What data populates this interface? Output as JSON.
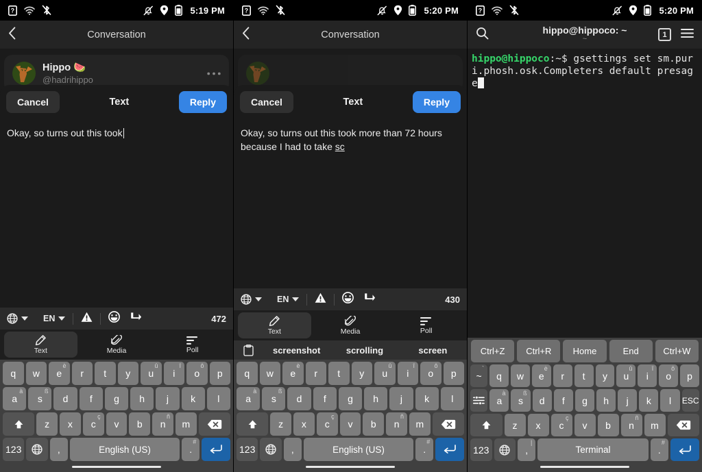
{
  "panels": [
    {
      "id": "panel-compose-start",
      "statusbar": {
        "time": "5:19 PM",
        "left_icons": [
          "help-badge-icon",
          "wifi-icon",
          "bluetooth-disabled-icon"
        ],
        "right_icons": [
          "notifications-off-icon",
          "location-icon",
          "battery-icon"
        ]
      },
      "header": {
        "title": "Conversation",
        "back": "‹"
      },
      "message": {
        "name": "Hippo",
        "name_emoji": "🍉",
        "handle": "@hadrihippo",
        "more": "•••"
      },
      "compose": {
        "cancel": "Cancel",
        "title": "Text",
        "reply": "Reply",
        "text": "Okay, so turns out this took",
        "composing": ""
      },
      "toolbar": {
        "globe": "globe-icon",
        "lang": "EN",
        "warning": "warning-icon",
        "emoji": "emoji-icon",
        "cursor": "cursor-move-icon",
        "count": "472"
      },
      "mode_tabs": [
        {
          "label": "Text",
          "icon": "pencil-icon",
          "active": true
        },
        {
          "label": "Media",
          "icon": "paperclip-icon",
          "active": false
        },
        {
          "label": "Poll",
          "icon": "poll-icon",
          "active": false
        }
      ],
      "suggestions": null,
      "keyboard": {
        "layout": "latin",
        "rows": [
          [
            {
              "label": "q",
              "alt": ""
            },
            {
              "label": "w",
              "alt": ""
            },
            {
              "label": "e",
              "alt": "è"
            },
            {
              "label": "r",
              "alt": ""
            },
            {
              "label": "t",
              "alt": ""
            },
            {
              "label": "y",
              "alt": ""
            },
            {
              "label": "u",
              "alt": "û"
            },
            {
              "label": "i",
              "alt": "î"
            },
            {
              "label": "o",
              "alt": "ô"
            },
            {
              "label": "p",
              "alt": ""
            }
          ],
          [
            {
              "label": "a",
              "alt": "à"
            },
            {
              "label": "s",
              "alt": "ß"
            },
            {
              "label": "d",
              "alt": ""
            },
            {
              "label": "f",
              "alt": ""
            },
            {
              "label": "g",
              "alt": ""
            },
            {
              "label": "h",
              "alt": ""
            },
            {
              "label": "j",
              "alt": ""
            },
            {
              "label": "k",
              "alt": ""
            },
            {
              "label": "l",
              "alt": ""
            }
          ],
          [
            {
              "label": "shift-icon",
              "alt": "",
              "kind": "dark",
              "width": "w15"
            },
            {
              "label": "z",
              "alt": ""
            },
            {
              "label": "x",
              "alt": ""
            },
            {
              "label": "c",
              "alt": "ç"
            },
            {
              "label": "v",
              "alt": ""
            },
            {
              "label": "b",
              "alt": ""
            },
            {
              "label": "n",
              "alt": "ñ"
            },
            {
              "label": "m",
              "alt": ""
            },
            {
              "label": "backspace-icon",
              "alt": "",
              "kind": "dark",
              "width": "w15"
            }
          ],
          [
            {
              "label": "123",
              "alt": "",
              "kind": "dark",
              "width": "w09"
            },
            {
              "label": "globe-icon",
              "alt": "",
              "kind": "dark",
              "width": "w09"
            },
            {
              "label": ",",
              "alt": "",
              "width": "narrow"
            },
            {
              "label": "English (US)",
              "alt": "",
              "width": "space"
            },
            {
              "label": ".",
              "alt": "#",
              "width": "narrow"
            },
            {
              "label": "enter-icon",
              "alt": "",
              "kind": "blue",
              "width": "w12"
            }
          ]
        ]
      }
    },
    {
      "id": "panel-compose-typed",
      "statusbar": {
        "time": "5:20 PM",
        "left_icons": [
          "help-badge-icon",
          "wifi-icon",
          "bluetooth-disabled-icon"
        ],
        "right_icons": [
          "notifications-off-icon",
          "location-icon",
          "battery-icon"
        ]
      },
      "header": {
        "title": "Conversation",
        "back": "‹"
      },
      "message": {
        "name": "",
        "name_emoji": "",
        "handle": "",
        "more": ""
      },
      "compose": {
        "cancel": "Cancel",
        "title": "Text",
        "reply": "Reply",
        "text": "Okay, so turns out this took more than 72 hours because I had to take ",
        "composing": "sc"
      },
      "toolbar": {
        "globe": "globe-icon",
        "lang": "EN",
        "warning": "warning-icon",
        "emoji": "emoji-icon",
        "cursor": "cursor-move-icon",
        "count": "430"
      },
      "mode_tabs": [
        {
          "label": "Text",
          "icon": "pencil-icon",
          "active": true
        },
        {
          "label": "Media",
          "icon": "paperclip-icon",
          "active": false
        },
        {
          "label": "Poll",
          "icon": "poll-icon",
          "active": false
        }
      ],
      "suggestions": {
        "clipboard_icon": "clipboard-icon",
        "words": [
          "screenshot",
          "scrolling",
          "screen"
        ]
      },
      "keyboard": {
        "layout": "latin",
        "rows": [
          [
            {
              "label": "q",
              "alt": ""
            },
            {
              "label": "w",
              "alt": ""
            },
            {
              "label": "e",
              "alt": "è"
            },
            {
              "label": "r",
              "alt": ""
            },
            {
              "label": "t",
              "alt": ""
            },
            {
              "label": "y",
              "alt": ""
            },
            {
              "label": "u",
              "alt": "û"
            },
            {
              "label": "i",
              "alt": "î"
            },
            {
              "label": "o",
              "alt": "ô"
            },
            {
              "label": "p",
              "alt": ""
            }
          ],
          [
            {
              "label": "a",
              "alt": "à"
            },
            {
              "label": "s",
              "alt": "ß"
            },
            {
              "label": "d",
              "alt": ""
            },
            {
              "label": "f",
              "alt": ""
            },
            {
              "label": "g",
              "alt": ""
            },
            {
              "label": "h",
              "alt": ""
            },
            {
              "label": "j",
              "alt": ""
            },
            {
              "label": "k",
              "alt": ""
            },
            {
              "label": "l",
              "alt": ""
            }
          ],
          [
            {
              "label": "shift-icon",
              "alt": "",
              "kind": "dark",
              "width": "w15"
            },
            {
              "label": "z",
              "alt": ""
            },
            {
              "label": "x",
              "alt": ""
            },
            {
              "label": "c",
              "alt": "ç"
            },
            {
              "label": "v",
              "alt": ""
            },
            {
              "label": "b",
              "alt": ""
            },
            {
              "label": "n",
              "alt": "ñ"
            },
            {
              "label": "m",
              "alt": ""
            },
            {
              "label": "backspace-icon",
              "alt": "",
              "kind": "dark",
              "width": "w15"
            }
          ],
          [
            {
              "label": "123",
              "alt": "",
              "kind": "dark",
              "width": "w09"
            },
            {
              "label": "globe-icon",
              "alt": "",
              "kind": "dark",
              "width": "w09"
            },
            {
              "label": ",",
              "alt": "",
              "width": "narrow"
            },
            {
              "label": "English (US)",
              "alt": "",
              "width": "space"
            },
            {
              "label": ".",
              "alt": "#",
              "width": "narrow"
            },
            {
              "label": "enter-icon",
              "alt": "",
              "kind": "blue",
              "width": "w12"
            }
          ]
        ]
      }
    },
    {
      "id": "panel-terminal",
      "statusbar": {
        "time": "5:20 PM",
        "left_icons": [
          "help-badge-icon",
          "wifi-icon",
          "bluetooth-disabled-icon"
        ],
        "right_icons": [
          "notifications-off-icon",
          "location-icon",
          "battery-icon"
        ]
      },
      "header": {
        "search_icon": "search-icon",
        "title": "hippo@hippoco: ~",
        "subtitle": "~",
        "tab_count": "1",
        "menu_icon": "hamburger-menu-icon"
      },
      "terminal": {
        "prompt_user": "hippo@hippoco",
        "prompt_path": ":~$",
        "command": " gsettings set sm.puri.phosh.osk.Completers default presage"
      },
      "modifier_row": [
        "Ctrl+Z",
        "Ctrl+R",
        "Home",
        "End",
        "Ctrl+W"
      ],
      "keyboard": {
        "layout": "terminal",
        "rows": [
          [
            {
              "label": "~",
              "alt": "`",
              "kind": "dark",
              "width": "w09"
            },
            {
              "label": "q",
              "alt": ""
            },
            {
              "label": "w",
              "alt": ""
            },
            {
              "label": "e",
              "alt": "è"
            },
            {
              "label": "r",
              "alt": ""
            },
            {
              "label": "t",
              "alt": ""
            },
            {
              "label": "y",
              "alt": ""
            },
            {
              "label": "u",
              "alt": "û"
            },
            {
              "label": "i",
              "alt": "î"
            },
            {
              "label": "o",
              "alt": "ô"
            },
            {
              "label": "p",
              "alt": ""
            }
          ],
          [
            {
              "label": "tab-icon",
              "alt": "",
              "kind": "dark",
              "width": "w09"
            },
            {
              "label": "a",
              "alt": "à"
            },
            {
              "label": "s",
              "alt": "ß"
            },
            {
              "label": "d",
              "alt": ""
            },
            {
              "label": "f",
              "alt": ""
            },
            {
              "label": "g",
              "alt": ""
            },
            {
              "label": "h",
              "alt": ""
            },
            {
              "label": "j",
              "alt": ""
            },
            {
              "label": "k",
              "alt": ""
            },
            {
              "label": "l",
              "alt": ""
            },
            {
              "label": "ESC",
              "alt": "",
              "kind": "dark",
              "width": "w09"
            }
          ],
          [
            {
              "label": "shift-icon",
              "alt": "",
              "kind": "dark",
              "width": "w15"
            },
            {
              "label": "z",
              "alt": ""
            },
            {
              "label": "x",
              "alt": ""
            },
            {
              "label": "c",
              "alt": "ç"
            },
            {
              "label": "v",
              "alt": ""
            },
            {
              "label": "b",
              "alt": ""
            },
            {
              "label": "n",
              "alt": "ñ"
            },
            {
              "label": "m",
              "alt": ""
            },
            {
              "label": "backspace-icon",
              "alt": "",
              "kind": "dark",
              "width": "w15"
            }
          ],
          [
            {
              "label": "123",
              "alt": "",
              "kind": "dark",
              "width": "w09"
            },
            {
              "label": "globe-icon",
              "alt": "",
              "kind": "dark",
              "width": "w09"
            },
            {
              "label": ",",
              "alt": "|",
              "width": "narrow"
            },
            {
              "label": "Terminal",
              "alt": "",
              "width": "space"
            },
            {
              "label": ".",
              "alt": "#",
              "width": "narrow"
            },
            {
              "label": "enter-icon",
              "alt": "",
              "kind": "blue",
              "width": "w12"
            }
          ]
        ]
      }
    }
  ],
  "colors": {
    "accent_blue": "#3584e4",
    "enter_blue": "#1c63a8",
    "key_light": "#7d7d7d",
    "key_dark": "#545454",
    "kbd_bg": "#404040",
    "prompt_green": "#36d66a",
    "avatar_bg": "#2f4a16"
  }
}
